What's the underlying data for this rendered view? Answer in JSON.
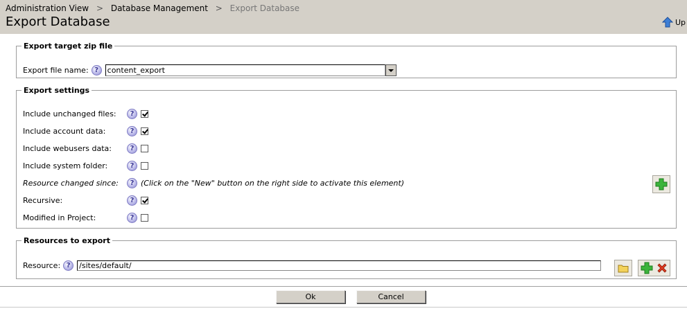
{
  "header": {
    "breadcrumb": [
      "Administration View",
      "Database Management",
      "Export Database"
    ],
    "breadcrumb_separator": ">",
    "title": "Export Database",
    "up_label": "Up"
  },
  "target": {
    "legend": "Export target zip file",
    "file_name_label": "Export file name:",
    "file_name_value": "content_export"
  },
  "settings": {
    "legend": "Export settings",
    "include_unchanged": {
      "label": "Include unchanged files:",
      "checked": true
    },
    "include_account": {
      "label": "Include account data:",
      "checked": true
    },
    "include_webusers": {
      "label": "Include webusers data:",
      "checked": false
    },
    "include_system": {
      "label": "Include system folder:",
      "checked": false
    },
    "resource_changed": {
      "label": "Resource changed since:",
      "note": "(Click on the \"New\" button on the right side to activate this element)"
    },
    "recursive": {
      "label": "Recursive:",
      "checked": true
    },
    "modified_in_project": {
      "label": "Modified in Project:",
      "checked": false
    }
  },
  "resources": {
    "legend": "Resources to export",
    "resource_label": "Resource:",
    "resource_value": "/sites/default/"
  },
  "help_glyph": "?",
  "buttons": {
    "ok": "Ok",
    "cancel": "Cancel"
  },
  "colors": {
    "header_bg": "#d4d0c8",
    "add_green": "#3cb43c",
    "remove_red": "#e03a1e"
  }
}
